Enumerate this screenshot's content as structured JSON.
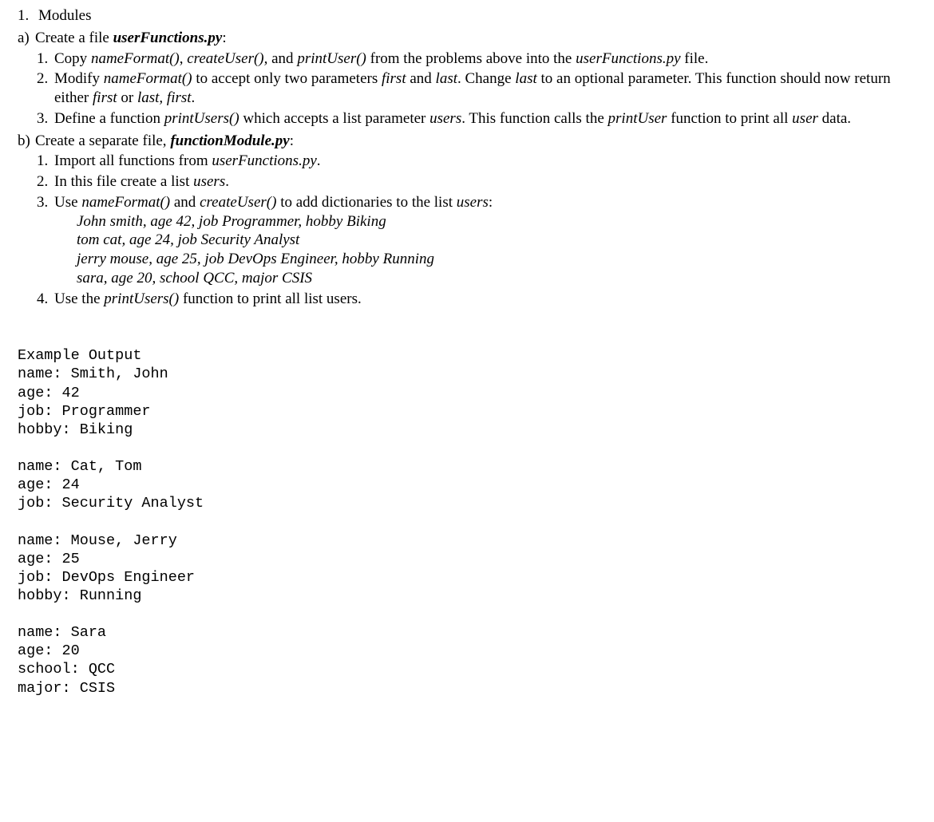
{
  "top": {
    "num": "1.",
    "label": "Modules"
  },
  "a": {
    "marker": "a)",
    "intro_prefix": "Create a file ",
    "intro_file": "userFunctions.py",
    "intro_suffix": ":",
    "items": {
      "i1": {
        "num": "1.",
        "t1": "Copy ",
        "f1": "nameFormat()",
        "t2": ", ",
        "f2": "createUser(),",
        "t3": " and ",
        "f3": "printUser()",
        "t4": " from the problems above into the ",
        "f4": "userFunctions.py",
        "t5": " file."
      },
      "i2": {
        "num": "2.",
        "t1": "Modify ",
        "f1": "nameFormat()",
        "t2": " to accept only two parameters ",
        "f2": "first",
        "t3": " and ",
        "f3": "last",
        "t4": ".  Change ",
        "f4": "last",
        "t5": " to an optional parameter.  This function should now return either ",
        "f5": "first",
        "t6": " or ",
        "f6": "last, first",
        "t7": "."
      },
      "i3": {
        "num": "3.",
        "t1": "Define a function ",
        "f1": "printUsers()",
        "t2": " which accepts a list parameter ",
        "f2": "users",
        "t3": ".  This function calls the ",
        "f3": "printUser",
        "t4": " function to print all ",
        "f4": "user",
        "t5": " data."
      }
    }
  },
  "b": {
    "marker": "b)",
    "intro_prefix": "Create a separate file, ",
    "intro_file": "functionModule.py",
    "intro_suffix": ":",
    "items": {
      "i1": {
        "num": "1.",
        "t1": "Import all functions from ",
        "f1": "userFunctions.py",
        "t2": "."
      },
      "i2": {
        "num": "2.",
        "t1": "In this file create a list ",
        "f1": "users",
        "t2": "."
      },
      "i3": {
        "num": "3.",
        "t1": "Use ",
        "f1": "nameFormat()",
        "t2": " and ",
        "f2": "createUser()",
        "t3": " to add dictionaries to the list ",
        "f3": "users",
        "t4": ":",
        "examples": {
          "e1": "John smith, age 42, job Programmer, hobby Biking",
          "e2": "tom cat, age 24, job Security Analyst",
          "e3": "jerry mouse, age 25, job DevOps Engineer, hobby Running",
          "e4": "sara, age 20, school QCC, major CSIS"
        }
      },
      "i4": {
        "num": "4.",
        "t1": "Use the ",
        "f1": "printUsers()",
        "t2": " function to print all list users."
      }
    }
  },
  "output": {
    "heading": "Example Output",
    "lines": "name: Smith, John\nage: 42\njob: Programmer\nhobby: Biking\n\nname: Cat, Tom\nage: 24\njob: Security Analyst\n\nname: Mouse, Jerry\nage: 25\njob: DevOps Engineer\nhobby: Running\n\nname: Sara\nage: 20\nschool: QCC\nmajor: CSIS"
  }
}
